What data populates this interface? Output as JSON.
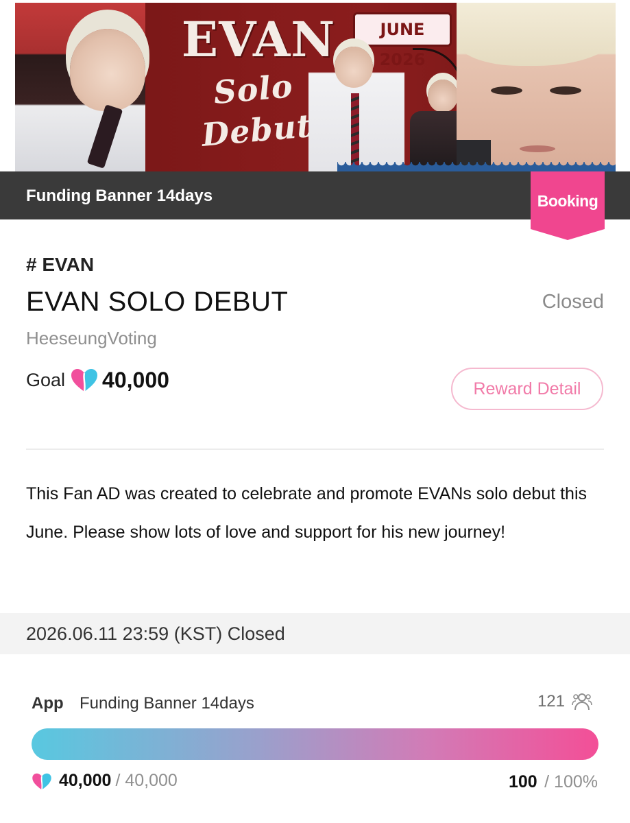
{
  "banner": {
    "title_main": "EVAN",
    "title_script": "Solo Debut",
    "date_tag": "JUNE 2026"
  },
  "header": {
    "title": "Funding Banner 14days",
    "badge": "Booking"
  },
  "info": {
    "hashtag": "# EVAN",
    "title": "EVAN SOLO DEBUT",
    "status": "Closed",
    "author": "HeeseungVoting",
    "goal_label": "Goal",
    "goal_value": "40,000",
    "reward_button": "Reward Detail"
  },
  "description": "This Fan AD was created to celebrate and promote EVANs solo debut this June. Please show lots of love and support for his new journey!",
  "close_notice": "2026.06.11 23:59 (KST) Closed",
  "progress": {
    "app_label": "App",
    "item": "Funding Banner 14days",
    "participants": "121",
    "amount": "40,000",
    "amount_goal": "/ 40,000",
    "percent": "100",
    "percent_total": "/ 100%",
    "fill_fraction": 1.0
  },
  "colors": {
    "accent_pink": "#f0468f",
    "header_dark": "#3a3a3a",
    "gradient_start": "#58c8e0",
    "gradient_end": "#f34f97"
  },
  "icons": {
    "heart": "heart-icon",
    "people": "people-icon"
  }
}
